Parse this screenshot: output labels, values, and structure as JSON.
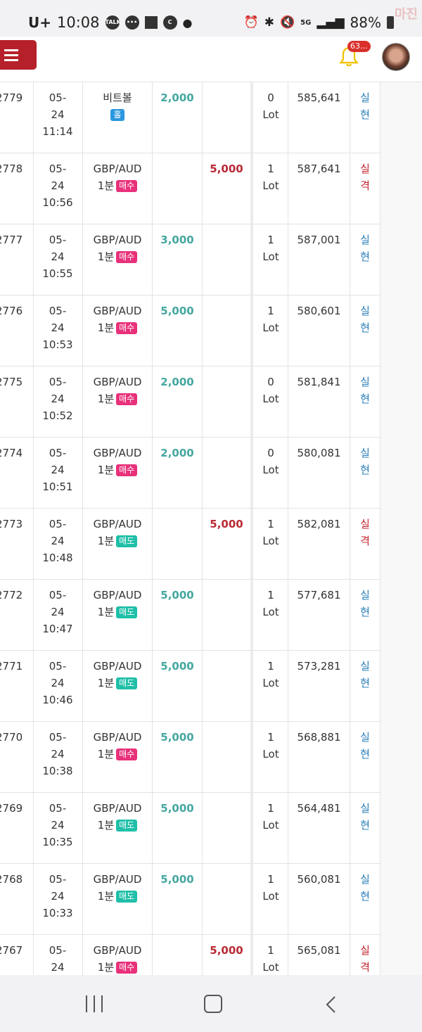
{
  "status_bar": {
    "carrier": "U+",
    "time": "10:08",
    "talk_icon_label": "TALK",
    "battery": "88%",
    "network_label": "5G"
  },
  "watermark": "마진",
  "app_bar": {
    "notification_count": "63..."
  },
  "colors": {
    "menu_button": "#b5202a",
    "profit": "#45a7a0",
    "loss": "#b92a35",
    "buy_tag": "#e8317a",
    "sell_tag": "#1fbfa8"
  },
  "rows": [
    {
      "id": "2779",
      "date_month": "05-",
      "date_day": "24",
      "time": "11:14",
      "symbol": "비트볼",
      "period": "",
      "side": "홀",
      "side_type": "hol",
      "profit": "2,000",
      "loss": "",
      "lot_num": "0",
      "lot_unit": "Lot",
      "balance": "585,641",
      "status_1": "실",
      "status_2": "현",
      "status_type": "win"
    },
    {
      "id": "2778",
      "date_month": "05-",
      "date_day": "24",
      "time": "10:56",
      "symbol": "GBP/AUD",
      "period": "1분",
      "side": "매수",
      "side_type": "buy",
      "profit": "",
      "loss": "5,000",
      "lot_num": "1",
      "lot_unit": "Lot",
      "balance": "587,641",
      "status_1": "실",
      "status_2": "격",
      "status_type": "loss"
    },
    {
      "id": "2777",
      "date_month": "05-",
      "date_day": "24",
      "time": "10:55",
      "symbol": "GBP/AUD",
      "period": "1분",
      "side": "매수",
      "side_type": "buy",
      "profit": "3,000",
      "loss": "",
      "lot_num": "1",
      "lot_unit": "Lot",
      "balance": "587,001",
      "status_1": "실",
      "status_2": "현",
      "status_type": "win"
    },
    {
      "id": "2776",
      "date_month": "05-",
      "date_day": "24",
      "time": "10:53",
      "symbol": "GBP/AUD",
      "period": "1분",
      "side": "매수",
      "side_type": "buy",
      "profit": "5,000",
      "loss": "",
      "lot_num": "1",
      "lot_unit": "Lot",
      "balance": "580,601",
      "status_1": "실",
      "status_2": "현",
      "status_type": "win"
    },
    {
      "id": "2775",
      "date_month": "05-",
      "date_day": "24",
      "time": "10:52",
      "symbol": "GBP/AUD",
      "period": "1분",
      "side": "매수",
      "side_type": "buy",
      "profit": "2,000",
      "loss": "",
      "lot_num": "0",
      "lot_unit": "Lot",
      "balance": "581,841",
      "status_1": "실",
      "status_2": "현",
      "status_type": "win"
    },
    {
      "id": "2774",
      "date_month": "05-",
      "date_day": "24",
      "time": "10:51",
      "symbol": "GBP/AUD",
      "period": "1분",
      "side": "매수",
      "side_type": "buy",
      "profit": "2,000",
      "loss": "",
      "lot_num": "0",
      "lot_unit": "Lot",
      "balance": "580,081",
      "status_1": "실",
      "status_2": "현",
      "status_type": "win"
    },
    {
      "id": "2773",
      "date_month": "05-",
      "date_day": "24",
      "time": "10:48",
      "symbol": "GBP/AUD",
      "period": "1분",
      "side": "매도",
      "side_type": "sell",
      "profit": "",
      "loss": "5,000",
      "lot_num": "1",
      "lot_unit": "Lot",
      "balance": "582,081",
      "status_1": "실",
      "status_2": "격",
      "status_type": "loss"
    },
    {
      "id": "2772",
      "date_month": "05-",
      "date_day": "24",
      "time": "10:47",
      "symbol": "GBP/AUD",
      "period": "1분",
      "side": "매도",
      "side_type": "sell",
      "profit": "5,000",
      "loss": "",
      "lot_num": "1",
      "lot_unit": "Lot",
      "balance": "577,681",
      "status_1": "실",
      "status_2": "현",
      "status_type": "win"
    },
    {
      "id": "2771",
      "date_month": "05-",
      "date_day": "24",
      "time": "10:46",
      "symbol": "GBP/AUD",
      "period": "1분",
      "side": "매도",
      "side_type": "sell",
      "profit": "5,000",
      "loss": "",
      "lot_num": "1",
      "lot_unit": "Lot",
      "balance": "573,281",
      "status_1": "실",
      "status_2": "현",
      "status_type": "win"
    },
    {
      "id": "2770",
      "date_month": "05-",
      "date_day": "24",
      "time": "10:38",
      "symbol": "GBP/AUD",
      "period": "1분",
      "side": "매수",
      "side_type": "buy",
      "profit": "5,000",
      "loss": "",
      "lot_num": "1",
      "lot_unit": "Lot",
      "balance": "568,881",
      "status_1": "실",
      "status_2": "현",
      "status_type": "win"
    },
    {
      "id": "2769",
      "date_month": "05-",
      "date_day": "24",
      "time": "10:35",
      "symbol": "GBP/AUD",
      "period": "1분",
      "side": "매도",
      "side_type": "sell",
      "profit": "5,000",
      "loss": "",
      "lot_num": "1",
      "lot_unit": "Lot",
      "balance": "564,481",
      "status_1": "실",
      "status_2": "현",
      "status_type": "win"
    },
    {
      "id": "2768",
      "date_month": "05-",
      "date_day": "24",
      "time": "10:33",
      "symbol": "GBP/AUD",
      "period": "1분",
      "side": "매도",
      "side_type": "sell",
      "profit": "5,000",
      "loss": "",
      "lot_num": "1",
      "lot_unit": "Lot",
      "balance": "560,081",
      "status_1": "실",
      "status_2": "현",
      "status_type": "win"
    },
    {
      "id": "2767",
      "date_month": "05-",
      "date_day": "24",
      "time": "",
      "symbol": "GBP/AUD",
      "period": "1분",
      "side": "매수",
      "side_type": "buy",
      "profit": "",
      "loss": "5,000",
      "lot_num": "1",
      "lot_unit": "Lot",
      "balance": "565,081",
      "status_1": "실",
      "status_2": "격",
      "status_type": "loss"
    }
  ]
}
